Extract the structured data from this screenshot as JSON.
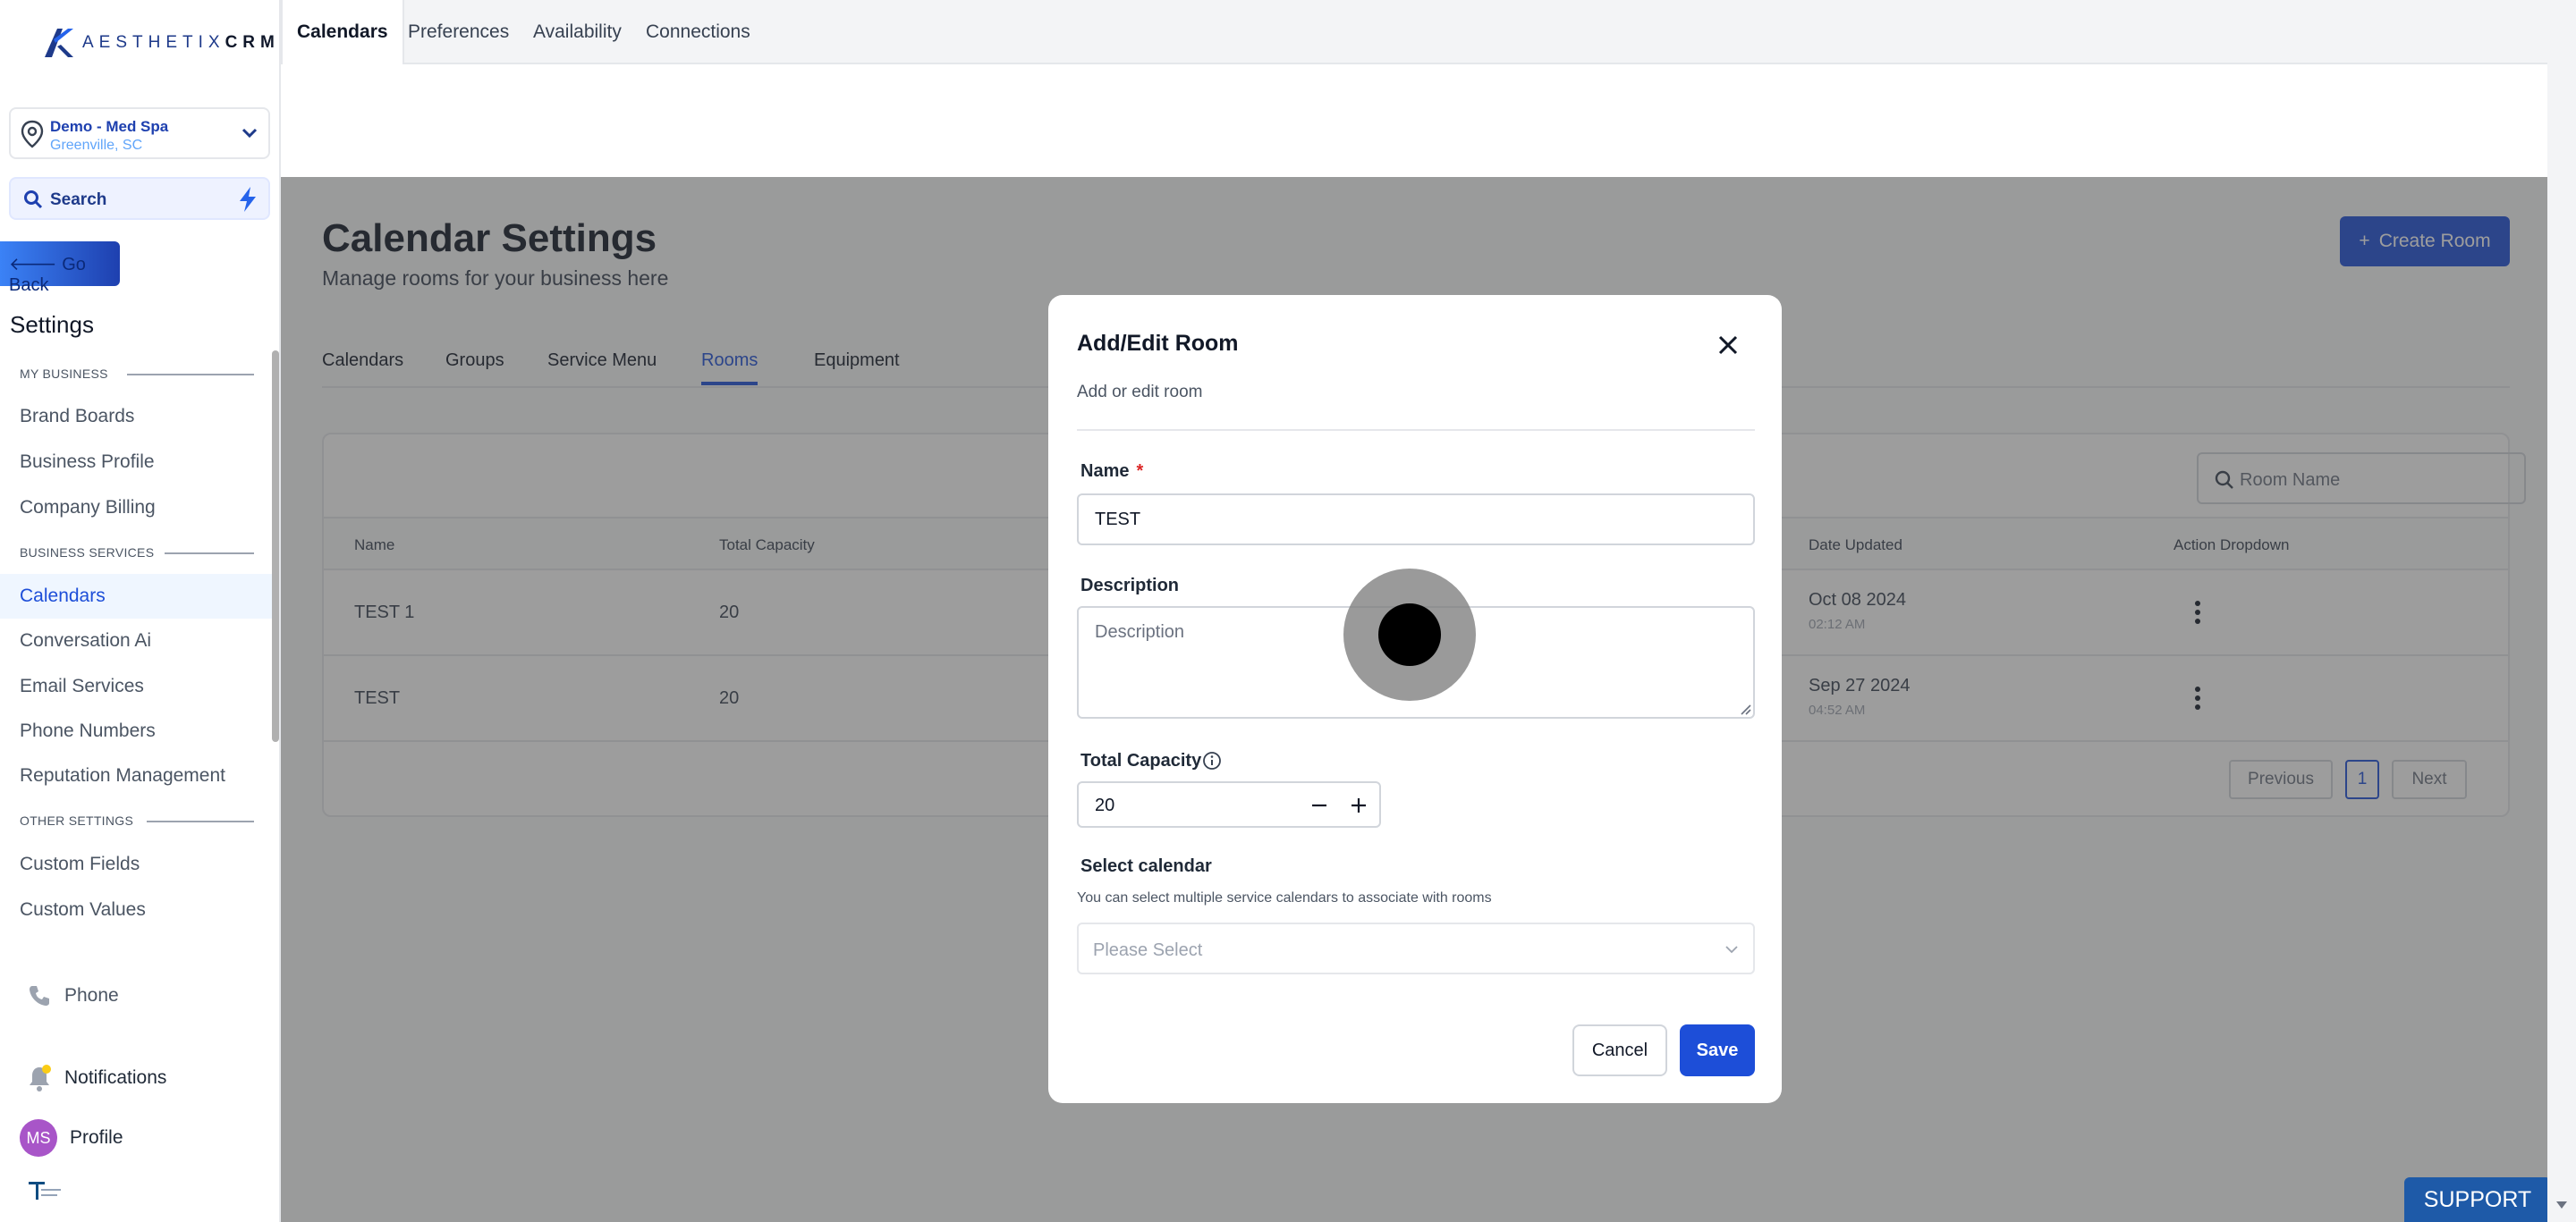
{
  "brand": {
    "name_light": "AESTHETIX",
    "name_bold": "CRM"
  },
  "location": {
    "name": "Demo - Med Spa",
    "city": "Greenville, SC"
  },
  "search": {
    "label": "Search"
  },
  "go_back": "Go Back",
  "settings_title": "Settings",
  "sidebar": {
    "sections": [
      {
        "header": "MY BUSINESS",
        "items": [
          "Brand Boards",
          "Business Profile",
          "Company Billing"
        ]
      },
      {
        "header": "BUSINESS SERVICES",
        "items": [
          "Calendars",
          "Conversation Ai",
          "Email Services",
          "Phone Numbers",
          "Reputation Management"
        ]
      },
      {
        "header": "OTHER SETTINGS",
        "items": [
          "Custom Fields",
          "Custom Values"
        ]
      }
    ],
    "active_item": "Calendars",
    "bottom": {
      "phone": "Phone",
      "notifications": "Notifications",
      "profile": "Profile",
      "profile_initials": "MS"
    }
  },
  "topnav": {
    "tabs": [
      "Calendars",
      "Preferences",
      "Availability",
      "Connections"
    ],
    "active": "Calendars"
  },
  "page": {
    "title": "Calendar Settings",
    "subtitle": "Manage rooms for your business here",
    "create_button": "Create Room",
    "subtabs": [
      "Calendars",
      "Groups",
      "Service Menu",
      "Rooms",
      "Equipment"
    ],
    "active_subtab": "Rooms"
  },
  "table": {
    "search_placeholder": "Room Name",
    "columns": [
      "Name",
      "Total Capacity",
      "Date Updated",
      "Action Dropdown"
    ],
    "rows": [
      {
        "name": "TEST 1",
        "capacity": "20",
        "date": "Oct 08 2024",
        "time": "02:12 AM"
      },
      {
        "name": "TEST",
        "capacity": "20",
        "date": "Sep 27 2024",
        "time": "04:52 AM"
      }
    ],
    "pagination": {
      "previous": "Previous",
      "current": "1",
      "next": "Next"
    }
  },
  "modal": {
    "title": "Add/Edit Room",
    "subtitle": "Add or edit room",
    "name_label": "Name",
    "name_required": "*",
    "name_value": "TEST",
    "description_label": "Description",
    "description_placeholder": "Description",
    "capacity_label": "Total Capacity",
    "capacity_value": "20",
    "calendar_label": "Select calendar",
    "calendar_help": "You can select multiple service calendars to associate with rooms",
    "calendar_placeholder": "Please Select",
    "cancel": "Cancel",
    "save": "Save"
  },
  "support": "SUPPORT",
  "colors": {
    "primary": "#1d4ed8",
    "overlay": "#808080",
    "avatar": "#a855c8",
    "support": "#1e5aa8"
  }
}
